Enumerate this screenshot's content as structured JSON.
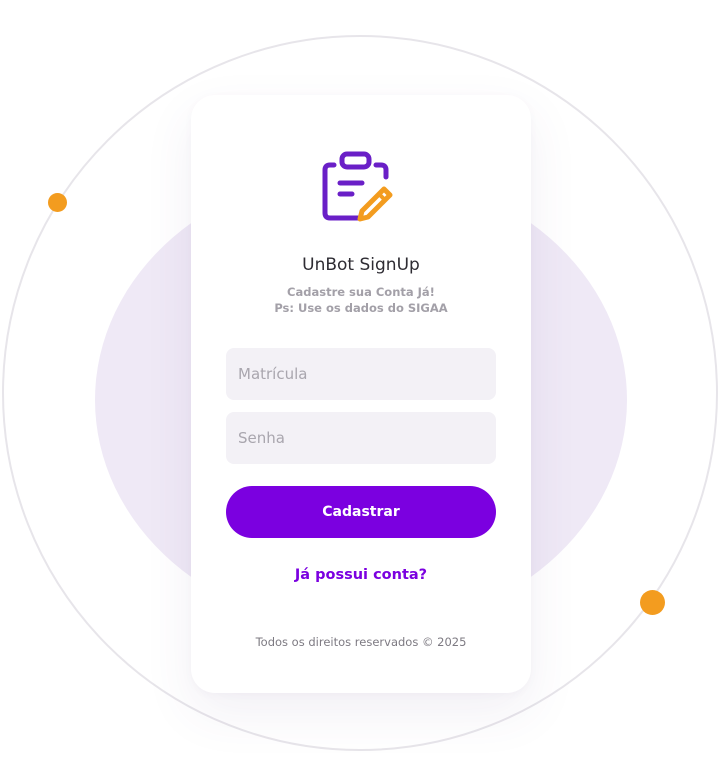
{
  "colors": {
    "accent": "#7b00e0",
    "logo_purple": "#6a1fc7",
    "logo_orange": "#f39c1f",
    "dot_orange": "#f39c1f",
    "blob": "#efe9f6",
    "field_bg": "#f3f1f6"
  },
  "logo": {
    "icon": "clipboard-edit-icon"
  },
  "header": {
    "title": "UnBot SignUp",
    "subtitle_line1": "Cadastre sua Conta Já!",
    "subtitle_line2": "Ps: Use os dados do SIGAA"
  },
  "form": {
    "matricula": {
      "placeholder": "Matrícula",
      "value": ""
    },
    "senha": {
      "placeholder": "Senha",
      "value": ""
    },
    "submit_label": "Cadastrar"
  },
  "login_link": {
    "label": "Já possui conta?"
  },
  "footer": {
    "text": "Todos os direitos reservados © 2025"
  }
}
